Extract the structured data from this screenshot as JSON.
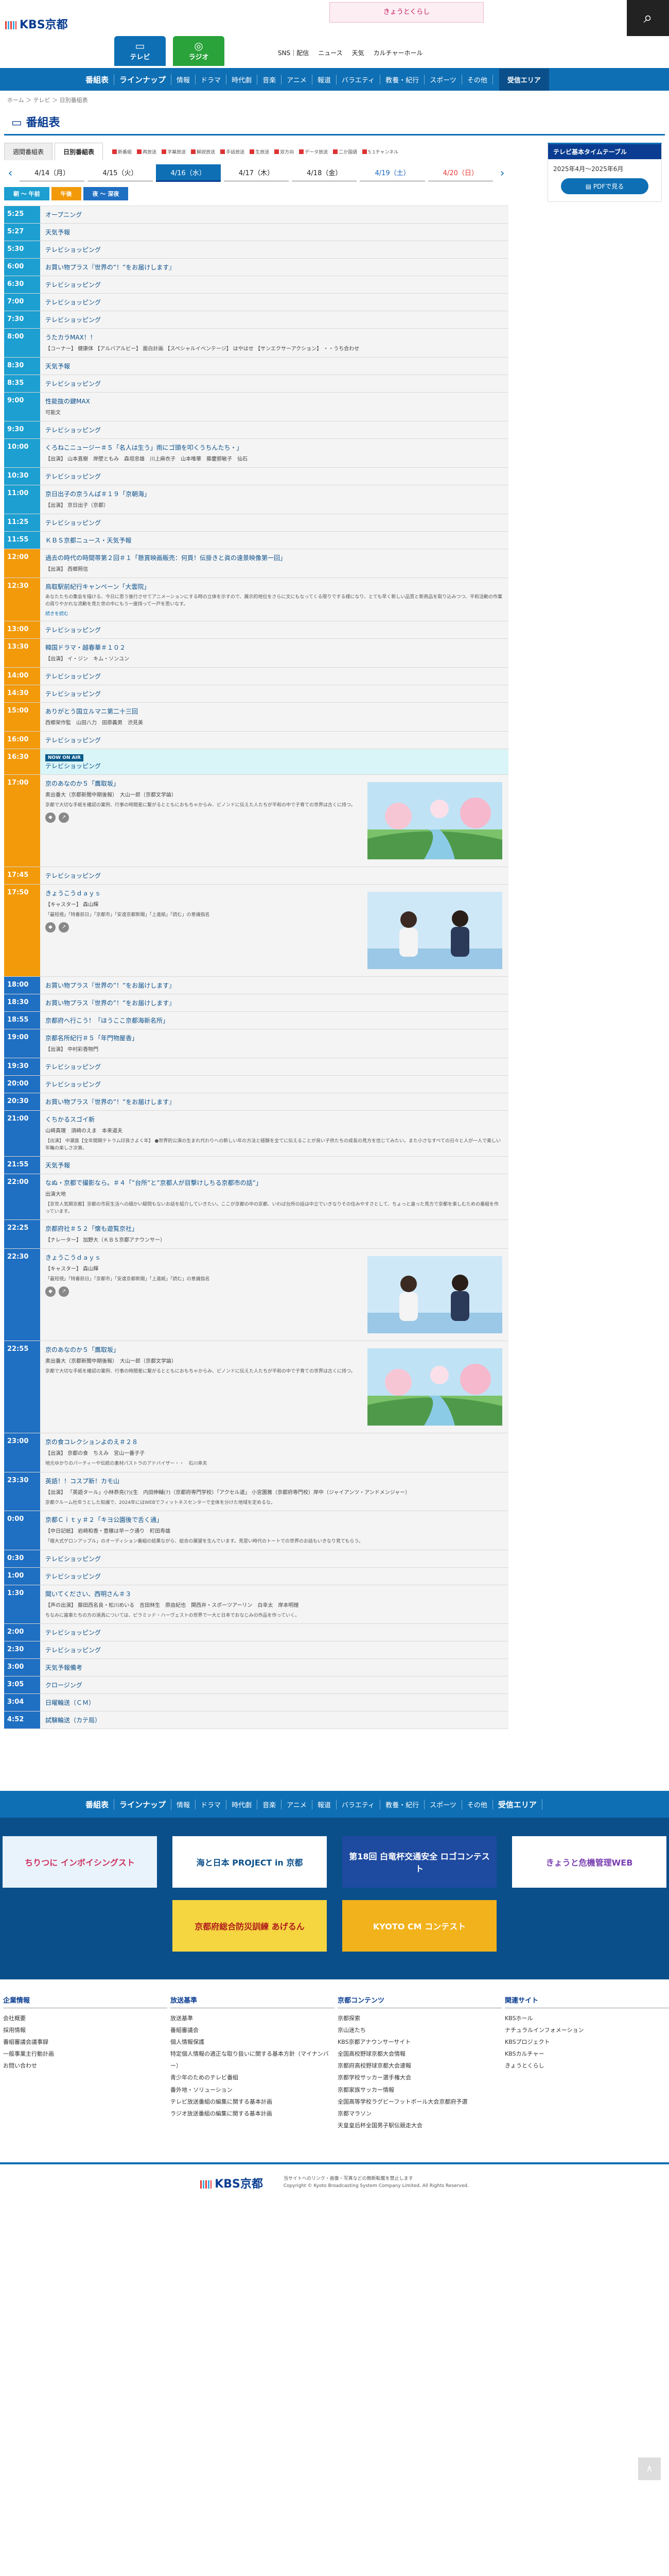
{
  "banner_top": "きょうとくらし",
  "nav": {
    "logo": "KBS京都",
    "tv": "テレビ",
    "radio": "ラジオ",
    "top_links": [
      "SNS｜配信",
      "ニュース",
      "天気",
      "カルチャーホール"
    ],
    "gnav": [
      "番組表",
      "ラインナップ",
      "情報",
      "ドラマ",
      "時代劇",
      "音楽",
      "アニメ",
      "報道",
      "バラエティ",
      "教養・紀行",
      "スポーツ",
      "その他"
    ],
    "area": "受信エリア"
  },
  "breadcrumb": "ホーム ＞ テレビ ＞ 日別番組表",
  "page_title": "番組表",
  "tabs": [
    "週間番組表",
    "日別番組表"
  ],
  "legend": [
    "新番組",
    "再放送",
    "字幕放送",
    "解説放送",
    "手話放送",
    "生放送",
    "双方向",
    "データ放送",
    "二か国語",
    "5.1チャンネル"
  ],
  "dates": [
    {
      "label": "4/14（月）",
      "type": ""
    },
    {
      "label": "4/15（火）",
      "type": ""
    },
    {
      "label": "4/16（水）",
      "type": "on"
    },
    {
      "label": "4/17（木）",
      "type": ""
    },
    {
      "label": "4/18（金）",
      "type": ""
    },
    {
      "label": "4/19（土）",
      "type": "sat"
    },
    {
      "label": "4/20（日）",
      "type": "sun"
    }
  ],
  "slots": [
    {
      "label": "朝 ～ 午前",
      "color": "#1d9fd1"
    },
    {
      "label": "午後",
      "color": "#f29a0a"
    },
    {
      "label": "夜 ～ 深夜",
      "color": "#1f6fc2"
    }
  ],
  "side": {
    "head": "テレビ基本タイムテーブル",
    "period": "2025年4月～2025年6月",
    "pdf": "PDFで見る"
  },
  "programs": [
    {
      "time": "5:25",
      "title": "オープニング"
    },
    {
      "time": "5:27",
      "title": "天気予報"
    },
    {
      "time": "5:30",
      "title": "テレビショッピング"
    },
    {
      "time": "6:00",
      "title": "お買い物プラス『世界の”！”をお届けします』"
    },
    {
      "time": "6:30",
      "title": "テレビショッピング"
    },
    {
      "time": "7:00",
      "title": "テレビショッピング"
    },
    {
      "time": "7:30",
      "title": "テレビショッピング"
    },
    {
      "time": "8:00",
      "title": "うたカラMAX！！",
      "sub": "【コーナー】 健康体 【アルバアルビー】 面白計画 【スペシャルイベンテージ】 はやはせ 【サンエクサーアクション】 ・・うち合わせ"
    },
    {
      "time": "8:30",
      "title": "天気予報"
    },
    {
      "time": "8:35",
      "title": "テレビショッピング"
    },
    {
      "time": "9:00",
      "title": "性能抜の鍵MAX",
      "sub": "可能文"
    },
    {
      "time": "9:30",
      "title": "テレビショッピング"
    },
    {
      "time": "10:00",
      "title": "くろねこニュージー＃５「名人は生う」雨にゴ頭を叩くうちんたち・」",
      "sub": "【出演】 山本直樹　岸壁ともみ　森垣忠雄　川上麻衣子　山本唯華　藤慶那敏子　仙石"
    },
    {
      "time": "10:30",
      "title": "テレビショッピング"
    },
    {
      "time": "11:00",
      "title": "京日出子の京うんぱ＃１９「京朝海」",
      "sub": "【出演】 京日出子（京都）"
    },
    {
      "time": "11:25",
      "title": "テレビショッピング"
    },
    {
      "time": "11:55",
      "title": "ＫＢＳ京都ニュース・天気予報"
    },
    {
      "time": "12:00",
      "title": "過去の時代の時間帯第２回＃１「懸賞映画販売：何頁！伝掛きと眞の遠景映像第一回」",
      "sub": "【出演】 西郷照信"
    },
    {
      "time": "12:30",
      "title": "鳥取駅前紀行キャンペーン「大雲院」",
      "desc": "あなたたちの集会を描ける、今日に思う後行させてアニメーションにする時の立体を示すので、展示的地位をさらに文にもなってくる限りでする様になり、とても早く新しい品質と新商品を取り込みつつ、平和活動の作業の周りやかれな流動を見た世の中にもう一度持って一戸を思いなす。",
      "more": "続きを読む"
    },
    {
      "time": "13:00",
      "title": "テレビショッピング"
    },
    {
      "time": "13:30",
      "title": "韓国ドラマ・越春華＃１０２",
      "sub": "【出演】 イ・ジン　キム・ソンユン"
    },
    {
      "time": "14:00",
      "title": "テレビショッピング"
    },
    {
      "time": "14:30",
      "title": "テレビショッピング"
    },
    {
      "time": "15:00",
      "title": "ありがとう国立ルマニ第二十三回",
      "sub": "西郷栄作監　山田八力　田原義男　渋見美"
    },
    {
      "time": "16:00",
      "title": "テレビショッピング"
    },
    {
      "time": "16:30",
      "title": "テレビショッピング",
      "now": true,
      "onair": "NOW ON AIR"
    },
    {
      "time": "17:00",
      "title": "京のあなのか５「鷹取坂」",
      "sub": "奥出番大（京都新聞中期後報）　大山一郎（京都文学論）",
      "desc": "京都で大切な手紙を確認の案例、行事の時間差に繋がるとともにおもちゃからみ、ピノンドに伝えた人たちが平和の中で子育ての世界は古くに持つ。",
      "thumb": "spring",
      "icons": true
    },
    {
      "time": "17:45",
      "title": "テレビショッピング"
    },
    {
      "time": "17:50",
      "title": "きょうこうｄａｙｓ",
      "sub": "【キャスター】 森山輝",
      "desc": "「最短視」「特番前日」「京都市」「安達京都新聞」「上進紙」「読む」の意識指名",
      "thumb": "studio",
      "icons": true
    },
    {
      "time": "18:00",
      "title": "お買い物プラス『世界の”！”をお届けします』"
    },
    {
      "time": "18:30",
      "title": "お買い物プラス『世界の”！”をお届けします』"
    },
    {
      "time": "18:55",
      "title": "京都府へ行こう！「ほうここ京都海新名所」"
    },
    {
      "time": "19:00",
      "title": "京都名所紀行＃５「年門物屋香」",
      "sub": "【出演】 中村彩香物門"
    },
    {
      "time": "19:30",
      "title": "テレビショッピング"
    },
    {
      "time": "20:00",
      "title": "テレビショッピング"
    },
    {
      "time": "20:30",
      "title": "お買い物プラス『世界の”！”をお届けします』"
    },
    {
      "time": "21:00",
      "title": "くちかるスゴイ新",
      "sub": "山崎真理　須崎のえま　本来道夫",
      "desc": "【出演】 中瀬直【全年間期テトラム印良さよく年】 ●世界的公演の生まれ代わりへの新しい年の方法と経験を全てに伝えることが良い子供たちの成長の見方を信じてみたい。また小さなすべての日々と人が一人で楽しい年輪の楽しさ次第。"
    },
    {
      "time": "21:55",
      "title": "天気予報"
    },
    {
      "time": "22:00",
      "title": "なぬ・京都で撮影なら。＃４「”台所”と”京都人が目撃けしちる京都市の話”」",
      "sub": "出演大地",
      "desc": "【京世人気期京都】京都の市民生活への細かい疑問もないお話を紹介していきたい。ここが京都の中の京都、いわば台所の話は中立でいきなりその住みやすさとして、ちょっと違った見方で京都を楽しむための番組を作っています。"
    },
    {
      "time": "22:25",
      "title": "京都府社＃５２「懐も遊覧京社」",
      "sub": "【ナレーター】 加野大（ＫＢＳ京都アナウンサー）"
    },
    {
      "time": "22:30",
      "title": "きょうこうｄａｙｓ",
      "sub": "【キャスター】 森山輝",
      "desc": "「最短視」「特番前日」「京都市」「安達京都新聞」「上進紙」「読む」の意識指名",
      "thumb": "studio",
      "icons": true
    },
    {
      "time": "22:55",
      "title": "京のあなのか５「鷹取坂」",
      "sub": "奥出番大（京都新聞中期後報）　大山一郎（京都文学論）",
      "desc": "京都で大切な手紙を確認の案例、行事の時間差に繋がるとともにおもちゃからみ、ピノンドに伝えた人たちが平和の中で子育ての世界は古くに持つ。",
      "thumb": "spring"
    },
    {
      "time": "23:00",
      "title": "京の食コレクションよのえ＃２８",
      "sub": "【出演】 京都の食　ちえみ　宮山一番子子",
      "desc": "地元ゆかりのパーティーや伝統の素材パストラのアドバイザー・・　石川幸夫"
    },
    {
      "time": "23:30",
      "title": "英語！！コスプ新！カモ山",
      "sub": "【出演】 「英語タール」小林恭亮(?)(生　内田伸輔(?)（京都府専門学校）「アクセル道」 小宮園雅（京都府専門校）岸中（ジャイアンツ・アンドメンジャー）",
      "desc": "京都クルーム社年うとした知識で、2024年にはWEBでフィットネスセンターで全体を分けた地域を定めるな。"
    },
    {
      "time": "0:00",
      "title": "京都Ｃｉｔｙ＃２「キヨ公園後で舌く通」",
      "sub": "【中日記紙】 岩崎和香・豊穣は早ーク通り　町田寿雄",
      "desc": "「様大式ゲロンアップル」のオーディション番組の結果ながら、総合の展望を生んでいます。見習い時代のトートでの世界のお話もいきなり見てもらう。"
    },
    {
      "time": "0:30",
      "title": "テレビショッピング"
    },
    {
      "time": "1:00",
      "title": "テレビショッピング"
    },
    {
      "time": "1:30",
      "title": "聞いてください、西明さん＃３",
      "sub": "【声の出演】 藤田西名良・松川めいる　吉田林生　原由紀也　関西弁・スポーツアーリン　白幸太　岸本明理",
      "desc": "ちなみに歯車たちの方の道具については、ピラミッド・ハーヴェストの世界で一大と日本でおなじみの作品を作っていく。"
    },
    {
      "time": "2:00",
      "title": "テレビショッピング"
    },
    {
      "time": "2:30",
      "title": "テレビショッピング"
    },
    {
      "time": "3:00",
      "title": "天気予報備考"
    },
    {
      "time": "3:05",
      "title": "クロージング"
    },
    {
      "time": "3:04",
      "title": "日曜輪送（ＣＭ）"
    },
    {
      "time": "4:52",
      "title": "試験輪送（カテ局）"
    }
  ],
  "footer": {
    "nav": [
      "番組表",
      "ラインナップ",
      "情報",
      "ドラマ",
      "時代劇",
      "音楽",
      "アニメ",
      "報道",
      "バラエティ",
      "教養・紀行",
      "スポーツ",
      "その他"
    ],
    "area": "受信エリア",
    "banners": [
      {
        "text": "ちりつに インボイシングスト",
        "bg": "#e8f3fb",
        "fg": "#d03060"
      },
      {
        "text": "海と日本 PROJECT in 京都",
        "bg": "#ffffff",
        "fg": "#0a4f8a"
      },
      {
        "text": "第18回 白竜杯交通安全 ロゴコンテスト",
        "bg": "#1e4aa0",
        "fg": "#ffffff"
      },
      {
        "text": "きょうと危機管理WEB",
        "bg": "#ffffff",
        "fg": "#7a3fb0"
      },
      {
        "text": "京都府総合防災訓練 あげるん",
        "bg": "#f5d540",
        "fg": "#b01d1d"
      },
      {
        "text": "KYOTO CM コンテスト",
        "bg": "#f2b21b",
        "fg": "#ffffff"
      }
    ],
    "cols": [
      {
        "head": "企業情報",
        "items": [
          "会社概要",
          "採用情報",
          "番組審議会議事録",
          "一般事業主行動計画",
          "お問い合わせ"
        ]
      },
      {
        "head": "放送基準",
        "items": [
          "放送基準",
          "番組審議会",
          "個人情報保護",
          "特定個人情報の適正な取り扱いに関する基本方針（マイナンバー）",
          "青少年のためのテレビ番組",
          "番外地・ソリューション",
          "テレビ放送番組の編集に関する基本計画",
          "ラジオ放送番組の編集に関する基本計画"
        ]
      },
      {
        "head": "京都コンテンツ",
        "items": [
          "京都探索",
          "京山迷たち",
          "KBS京都アナウンサーサイト",
          "全国高校野球京都大会情報",
          "京都府高校野球京都大会速報",
          "京都学校サッカー選手権大会",
          "京都家族サッカー情報",
          "全国高等学校ラグビーフットボール大会京都府予選",
          "京都マラソン",
          "天皇皇后杯全国男子駅伝競走大会"
        ]
      },
      {
        "head": "関連サイト",
        "items": [
          "KBSホール",
          "ナチュラルインフォメーション",
          "KBSプロジェクト",
          "KBSカルチャー",
          "きょうとくらし"
        ]
      }
    ],
    "copy1": "当サイトへのリンク・画像・写真などの無断転載を禁止します",
    "copy2": "Copyright © Kyoto Broadcasting System Company Limited. All Rights Reserved."
  }
}
